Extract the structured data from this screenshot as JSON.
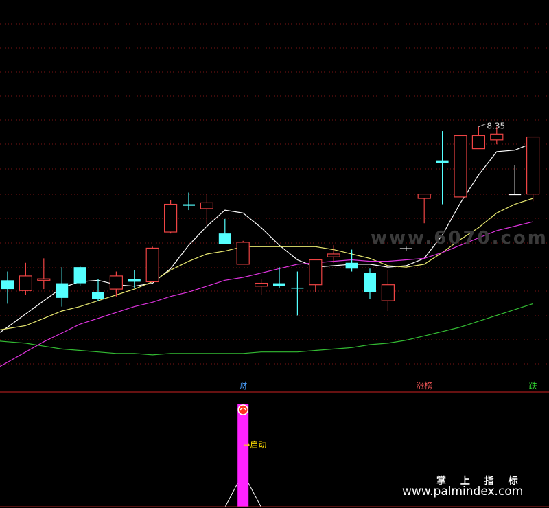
{
  "chart_data": [
    {
      "type": "candlestick",
      "peak_label": "8.35",
      "candles": [
        {
          "o": 6.48,
          "h": 6.54,
          "l": 6.32,
          "c": 6.42,
          "color": "cyan"
        },
        {
          "o": 6.41,
          "h": 6.6,
          "l": 6.38,
          "c": 6.51,
          "color": "red"
        },
        {
          "o": 6.48,
          "h": 6.63,
          "l": 6.42,
          "c": 6.49,
          "color": "red"
        },
        {
          "o": 6.46,
          "h": 6.57,
          "l": 6.3,
          "c": 6.36,
          "color": "cyan"
        },
        {
          "o": 6.57,
          "h": 6.58,
          "l": 6.44,
          "c": 6.46,
          "color": "cyan"
        },
        {
          "o": 6.4,
          "h": 6.49,
          "l": 6.34,
          "c": 6.35,
          "color": "cyan"
        },
        {
          "o": 6.42,
          "h": 6.54,
          "l": 6.37,
          "c": 6.51,
          "color": "red"
        },
        {
          "o": 6.49,
          "h": 6.55,
          "l": 6.43,
          "c": 6.47,
          "color": "cyan"
        },
        {
          "o": 6.47,
          "h": 6.71,
          "l": 6.47,
          "c": 6.7,
          "color": "red"
        },
        {
          "o": 6.81,
          "h": 7.03,
          "l": 6.8,
          "c": 7.0,
          "color": "red"
        },
        {
          "o": 7.0,
          "h": 7.08,
          "l": 6.96,
          "c": 6.99,
          "color": "cyan"
        },
        {
          "o": 6.97,
          "h": 7.07,
          "l": 6.86,
          "c": 7.01,
          "color": "red"
        },
        {
          "o": 6.8,
          "h": 6.9,
          "l": 6.73,
          "c": 6.73,
          "color": "cyan"
        },
        {
          "o": 6.59,
          "h": 6.75,
          "l": 6.59,
          "c": 6.74,
          "color": "red"
        },
        {
          "o": 6.46,
          "h": 6.49,
          "l": 6.38,
          "c": 6.44,
          "color": "red"
        },
        {
          "o": 6.46,
          "h": 6.57,
          "l": 6.43,
          "c": 6.44,
          "color": "cyan"
        },
        {
          "o": 6.43,
          "h": 6.54,
          "l": 6.24,
          "c": 6.43,
          "color": "cyan"
        },
        {
          "o": 6.45,
          "h": 6.61,
          "l": 6.4,
          "c": 6.62,
          "color": "red"
        },
        {
          "o": 6.64,
          "h": 6.72,
          "l": 6.6,
          "c": 6.66,
          "color": "red"
        },
        {
          "o": 6.6,
          "h": 6.69,
          "l": 6.54,
          "c": 6.56,
          "color": "cyan"
        },
        {
          "o": 6.53,
          "h": 6.56,
          "l": 6.35,
          "c": 6.4,
          "color": "cyan"
        },
        {
          "o": 6.34,
          "h": 6.55,
          "l": 6.27,
          "c": 6.45,
          "color": "red"
        },
        {
          "o": 6.7,
          "h": 6.71,
          "l": 6.68,
          "c": 6.7,
          "color": "white"
        },
        {
          "o": 7.04,
          "h": 7.06,
          "l": 6.87,
          "c": 7.07,
          "color": "red"
        },
        {
          "o": 7.3,
          "h": 7.5,
          "l": 7.0,
          "c": 7.28,
          "color": "cyan"
        },
        {
          "o": 7.05,
          "h": 7.47,
          "l": 7.05,
          "c": 7.47,
          "color": "red"
        },
        {
          "o": 7.38,
          "h": 7.53,
          "l": 7.38,
          "c": 7.47,
          "color": "red"
        },
        {
          "o": 7.44,
          "h": 7.53,
          "l": 7.41,
          "c": 7.48,
          "color": "red"
        },
        {
          "o": 7.07,
          "h": 7.27,
          "l": 7.07,
          "c": 7.07,
          "color": "white"
        },
        {
          "o": 7.07,
          "h": 7.46,
          "l": 7.02,
          "c": 7.46,
          "color": "red"
        }
      ],
      "moving_averages": [
        {
          "color": "#ffffff",
          "values": [
            6.16,
            6.25,
            6.34,
            6.43,
            6.47,
            6.48,
            6.45,
            6.44,
            6.46,
            6.56,
            6.72,
            6.85,
            6.96,
            6.94,
            6.84,
            6.72,
            6.62,
            6.57,
            6.58,
            6.59,
            6.59,
            6.57,
            6.58,
            6.63,
            6.79,
            7.01,
            7.2,
            7.36,
            7.37,
            7.42
          ]
        },
        {
          "color": "#e8e870",
          "values": [
            6.15,
            6.17,
            6.22,
            6.27,
            6.3,
            6.34,
            6.38,
            6.42,
            6.47,
            6.55,
            6.61,
            6.66,
            6.68,
            6.71,
            6.71,
            6.71,
            6.71,
            6.71,
            6.69,
            6.66,
            6.63,
            6.58,
            6.57,
            6.59,
            6.67,
            6.76,
            6.84,
            6.94,
            7.0,
            7.04
          ]
        },
        {
          "color": "#dd33dd",
          "values": [
            5.92,
            5.99,
            6.06,
            6.12,
            6.18,
            6.22,
            6.26,
            6.3,
            6.33,
            6.37,
            6.4,
            6.44,
            6.48,
            6.5,
            6.53,
            6.56,
            6.59,
            6.6,
            6.61,
            6.62,
            6.61,
            6.61,
            6.62,
            6.63,
            6.67,
            6.72,
            6.77,
            6.82,
            6.85,
            6.88
          ]
        },
        {
          "color": "#33bb33",
          "values": [
            6.06,
            6.05,
            6.03,
            6.01,
            6.0,
            5.99,
            5.98,
            5.98,
            5.97,
            5.98,
            5.98,
            5.98,
            5.98,
            5.98,
            5.99,
            5.99,
            5.99,
            6.0,
            6.01,
            6.02,
            6.04,
            6.05,
            6.07,
            6.1,
            6.13,
            6.16,
            6.2,
            6.24,
            6.28,
            6.32
          ]
        }
      ],
      "gridlines": "dotted red, horizontal"
    },
    {
      "type": "signal",
      "signal_bar": {
        "index": 13,
        "label": "→启动"
      },
      "markers": [
        {
          "index": 13,
          "text": "财",
          "color": "#4aa0ff"
        },
        {
          "index": 23,
          "text": "涨榜",
          "color": "#ee5555"
        },
        {
          "index": 29,
          "text": "跌",
          "color": "#33dd33"
        }
      ]
    }
  ],
  "watermarks": {
    "site1": "www.6070.com",
    "site2_title": "掌 上 指 标",
    "site2_url": "www.palmindex.com"
  }
}
